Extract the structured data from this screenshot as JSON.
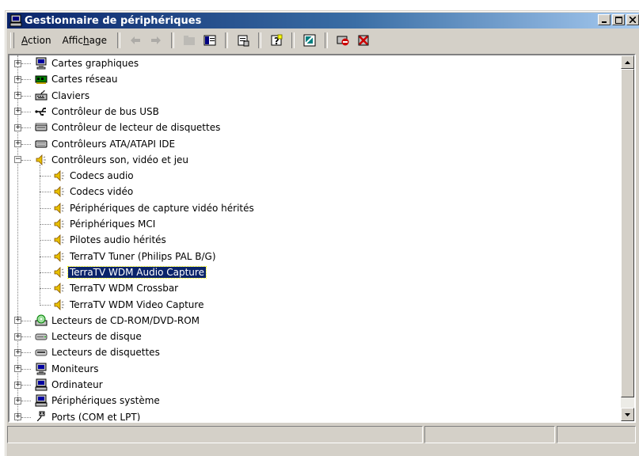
{
  "window": {
    "title": "Gestionnaire de périphériques",
    "title_icon": "computer-icon",
    "controls": [
      "minimize-icon",
      "maximize-icon",
      "close-icon"
    ]
  },
  "menu": {
    "action": "Action",
    "view": "Affichage"
  },
  "toolbar": {
    "buttons": [
      {
        "name": "back",
        "icon": "arrow-left-icon",
        "enabled": false
      },
      {
        "name": "forward",
        "icon": "arrow-right-icon",
        "enabled": false
      },
      {
        "name": "up",
        "icon": "folder-up-icon",
        "enabled": false
      },
      {
        "name": "show-hide-tree",
        "icon": "console-tree-icon",
        "enabled": true
      },
      {
        "name": "properties",
        "icon": "properties-icon",
        "enabled": true
      },
      {
        "name": "help",
        "icon": "help-icon",
        "enabled": true
      },
      {
        "name": "scan-hardware",
        "icon": "scan-hardware-icon",
        "enabled": true
      },
      {
        "name": "disable-device",
        "icon": "disable-device-icon",
        "enabled": true
      },
      {
        "name": "uninstall-device",
        "icon": "uninstall-icon",
        "enabled": true
      }
    ]
  },
  "tree": {
    "top_level": [
      {
        "label": "Cartes graphiques",
        "icon": "monitor-icon",
        "expanded": false
      },
      {
        "label": "Cartes réseau",
        "icon": "network-card-icon",
        "expanded": false
      },
      {
        "label": "Claviers",
        "icon": "keyboard-icon",
        "expanded": false
      },
      {
        "label": "Contrôleur de bus USB",
        "icon": "usb-icon",
        "expanded": false
      },
      {
        "label": "Contrôleur de lecteur de disquettes",
        "icon": "floppy-controller-icon",
        "expanded": false
      },
      {
        "label": "Contrôleurs ATA/ATAPI IDE",
        "icon": "ide-controller-icon",
        "expanded": false
      },
      {
        "label": "Contrôleurs son, vidéo et jeu",
        "icon": "speaker-icon",
        "expanded": true,
        "children": [
          {
            "label": "Codecs audio",
            "icon": "speaker-icon"
          },
          {
            "label": "Codecs vidéo",
            "icon": "speaker-icon"
          },
          {
            "label": "Périphériques de capture vidéo hérités",
            "icon": "speaker-icon"
          },
          {
            "label": "Périphériques MCI",
            "icon": "speaker-icon"
          },
          {
            "label": "Pilotes audio hérités",
            "icon": "speaker-icon"
          },
          {
            "label": "TerraTV Tuner (Philips PAL B/G)",
            "icon": "speaker-icon"
          },
          {
            "label": "TerraTV WDM Audio Capture",
            "icon": "speaker-icon",
            "selected": true
          },
          {
            "label": "TerraTV WDM Crossbar",
            "icon": "speaker-icon"
          },
          {
            "label": "TerraTV WDM Video Capture",
            "icon": "speaker-icon"
          }
        ]
      },
      {
        "label": "Lecteurs de CD-ROM/DVD-ROM",
        "icon": "cdrom-icon",
        "expanded": false
      },
      {
        "label": "Lecteurs de disque",
        "icon": "disk-drive-icon",
        "expanded": false
      },
      {
        "label": "Lecteurs de disquettes",
        "icon": "floppy-drive-icon",
        "expanded": false
      },
      {
        "label": "Moniteurs",
        "icon": "monitor-icon",
        "expanded": false
      },
      {
        "label": "Ordinateur",
        "icon": "computer-icon",
        "expanded": false
      },
      {
        "label": "Périphériques système",
        "icon": "computer-icon",
        "expanded": false
      },
      {
        "label": "Ports (COM et LPT)",
        "icon": "port-icon",
        "expanded": false
      }
    ]
  },
  "colors": {
    "title_start": "#0a246a",
    "title_end": "#a6caf0",
    "selection": "#0a246a",
    "face": "#d4d0c8"
  }
}
